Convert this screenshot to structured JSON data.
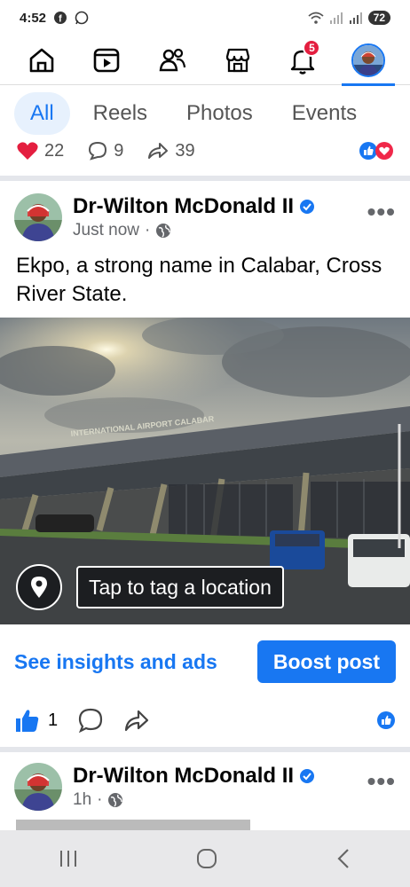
{
  "status_bar": {
    "time": "4:52",
    "battery": "72"
  },
  "nav": {
    "items": [
      {
        "name": "home"
      },
      {
        "name": "video"
      },
      {
        "name": "friends"
      },
      {
        "name": "marketplace"
      },
      {
        "name": "notifications",
        "badge": "5"
      },
      {
        "name": "profile"
      }
    ]
  },
  "filter_tabs": [
    "All",
    "Reels",
    "Photos",
    "Events"
  ],
  "previous_post": {
    "reactions": "22",
    "comments": "9",
    "shares": "39"
  },
  "post": {
    "author": "Dr-Wilton McDonald II",
    "time": "Just now",
    "text": "Ekpo,  a strong name in Calabar, Cross River State.",
    "photo_sign": "INTERNATIONAL AIRPORT CALABAR",
    "tag_location_label": "Tap to tag a location",
    "insights_label": "See insights and ads",
    "boost_label": "Boost post",
    "like_count": "1"
  },
  "post2": {
    "author": "Dr-Wilton McDonald II",
    "time": "1h"
  },
  "colors": {
    "accent": "#1877f2",
    "badge": "#e41e3f",
    "verified": "#1877f2"
  }
}
